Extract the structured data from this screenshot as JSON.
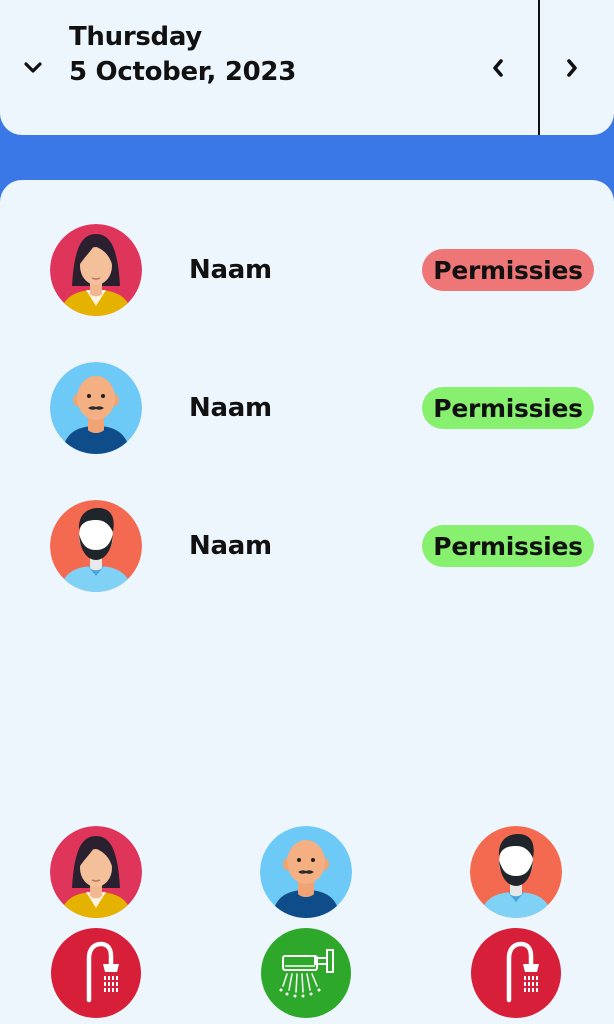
{
  "header": {
    "day": "Thursday",
    "date": "5 October, 2023",
    "icons": {
      "toggle": "chevron-down-icon",
      "prev": "chevron-left-icon",
      "next": "chevron-right-icon"
    }
  },
  "people": [
    {
      "name": "Naam",
      "permission_label": "Permissies",
      "permission_status": "denied",
      "status_color": "#ee7676",
      "avatar": "woman-avatar-icon"
    },
    {
      "name": "Naam",
      "permission_label": "Permissies",
      "permission_status": "granted",
      "status_color": "#88f06f",
      "avatar": "bald-man-avatar-icon"
    },
    {
      "name": "Naam",
      "permission_label": "Permissies",
      "permission_status": "granted",
      "status_color": "#88f06f",
      "avatar": "bearded-man-avatar-icon"
    }
  ],
  "showers": [
    {
      "avatar": "woman-avatar-icon",
      "shower_icon": "shower-head-icon",
      "status_color": "#d71f3a"
    },
    {
      "avatar": "bald-man-avatar-icon",
      "shower_icon": "wall-shower-icon",
      "status_color": "#2ea82a"
    },
    {
      "avatar": "bearded-man-avatar-icon",
      "shower_icon": "shower-head-icon",
      "status_color": "#d71f3a"
    }
  ],
  "colors": {
    "background": "#3b78e7",
    "panel": "#eef6fd",
    "text": "#111111"
  }
}
